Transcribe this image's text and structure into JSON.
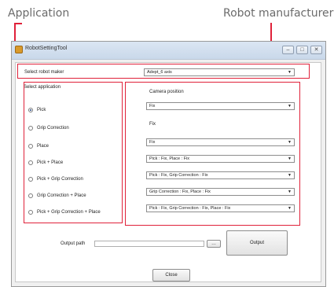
{
  "callouts": {
    "application": "Application",
    "robot_manufacturer": "Robot manufacturer"
  },
  "window": {
    "title": "RobotSettingTool",
    "controls": [
      "–",
      "□",
      "✕"
    ]
  },
  "maker": {
    "label": "Select robot maker",
    "value": "Adept_6 axis"
  },
  "application": {
    "label": "Select application",
    "options": [
      {
        "label": "Pick",
        "selected": true
      },
      {
        "label": "Grip Correction",
        "selected": false
      },
      {
        "label": "Place",
        "selected": false
      },
      {
        "label": "Pick + Place",
        "selected": false
      },
      {
        "label": "Pick + Grip Correction",
        "selected": false
      },
      {
        "label": "Grip Correction + Place",
        "selected": false
      },
      {
        "label": "Pick + Grip Correction + Place",
        "selected": false
      }
    ]
  },
  "camera": {
    "label": "Camera position",
    "rows": [
      {
        "kind": "combo",
        "value": "Fix"
      },
      {
        "kind": "text",
        "value": "Fix"
      },
      {
        "kind": "combo",
        "value": "Fix"
      },
      {
        "kind": "combo",
        "value": "Pick : Fix, Place : Fix"
      },
      {
        "kind": "combo",
        "value": "Pick : Fix, Grip Correction : Fix"
      },
      {
        "kind": "combo",
        "value": "Grip Correction : Fix, Place : Fix"
      },
      {
        "kind": "combo",
        "value": "Pick : Fix, Grip Correction : Fix, Place : Fix"
      }
    ]
  },
  "output": {
    "path_label": "Output path",
    "browse_label": "…",
    "output_label": "Output",
    "close_label": "Close"
  },
  "colors": {
    "callout_red": "#e0213a",
    "window_bg": "#f0f0f0"
  },
  "icons": {
    "combo_arrow": "▼",
    "app_icon": "robot-app-icon"
  }
}
